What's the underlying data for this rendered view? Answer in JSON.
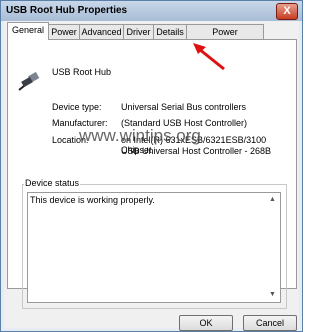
{
  "window": {
    "title": "USB Root Hub Properties",
    "close_label": "X"
  },
  "tabs": [
    {
      "label": "General"
    },
    {
      "label": "Power"
    },
    {
      "label": "Advanced"
    },
    {
      "label": "Driver"
    },
    {
      "label": "Details"
    },
    {
      "label": "Power Management"
    }
  ],
  "active_tab": "General",
  "device": {
    "name": "USB Root Hub",
    "icon": "usb-plug-icon",
    "fields": [
      {
        "label": "Device type:",
        "value": "Universal Serial Bus controllers"
      },
      {
        "label": "Manufacturer:",
        "value": "(Standard USB Host Controller)"
      },
      {
        "label": "Location:",
        "value": "on Intel(R) 631xESB/6321ESB/3100 Chipset",
        "value2": "USB Universal Host Controller - 268B"
      }
    ]
  },
  "status": {
    "group_label": "Device status",
    "text": "This device is working properly."
  },
  "watermark": "www.wintips.org",
  "buttons": {
    "ok": "OK",
    "cancel": "Cancel"
  },
  "colors": {
    "annotation_arrow": "#e01010",
    "close_button": "#c53c22",
    "titlebar": "#b7c9df"
  }
}
